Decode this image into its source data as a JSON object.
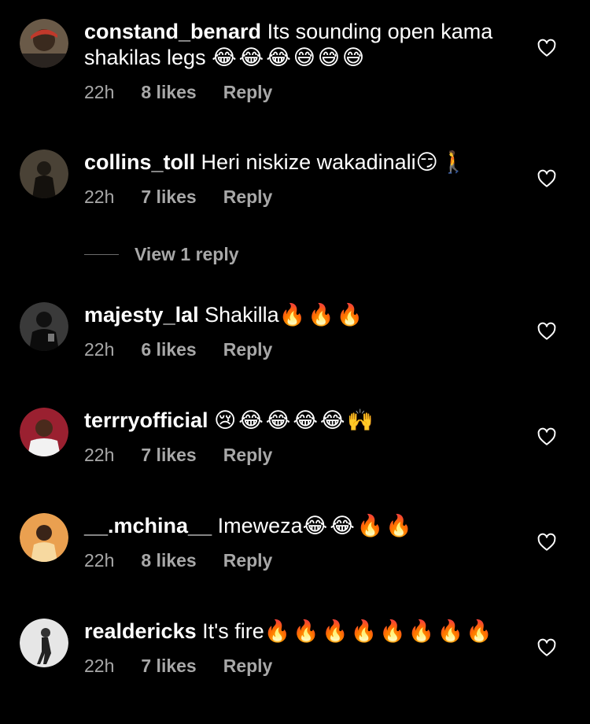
{
  "comments": [
    {
      "username": "constand_benard",
      "text": "Its sounding open kama shakilas legs ",
      "emoji": "😂😂😂😅😅😅",
      "time": "22h",
      "likes": "8 likes",
      "reply": "Reply",
      "avatar_color": "#4a3a2e"
    },
    {
      "username": "collins_toll",
      "text": "Heri niskize wakadinali",
      "emoji": "😏🚶",
      "time": "22h",
      "likes": "7 likes",
      "reply": "Reply",
      "avatar_color": "#3a3328"
    },
    {
      "username": "majesty_lal",
      "text": "Shakilla",
      "emoji": "🔥🔥🔥",
      "time": "22h",
      "likes": "6 likes",
      "reply": "Reply",
      "avatar_color": "#2a2a2a"
    },
    {
      "username": "terrryofficial",
      "text": "",
      "emoji": "😢😂😂😂😂🙌",
      "time": "22h",
      "likes": "7 likes",
      "reply": "Reply",
      "avatar_color": "#8a2030"
    },
    {
      "username": "__.mchina__",
      "text": "Imeweza",
      "emoji": "😂😂🔥🔥",
      "time": "22h",
      "likes": "8 likes",
      "reply": "Reply",
      "avatar_color": "#e8a050"
    },
    {
      "username": "realdericks",
      "text": "It's fire",
      "emoji": "🔥🔥🔥🔥🔥🔥🔥🔥",
      "time": "22h",
      "likes": "7 likes",
      "reply": "Reply",
      "avatar_color": "#e6e6e6"
    }
  ],
  "view_replies": {
    "label": "View 1 reply"
  },
  "colors": {
    "background": "#000000",
    "meta": "#a8a8a8",
    "text": "#ffffff"
  },
  "icons": {
    "like": "heart-outline-icon"
  }
}
